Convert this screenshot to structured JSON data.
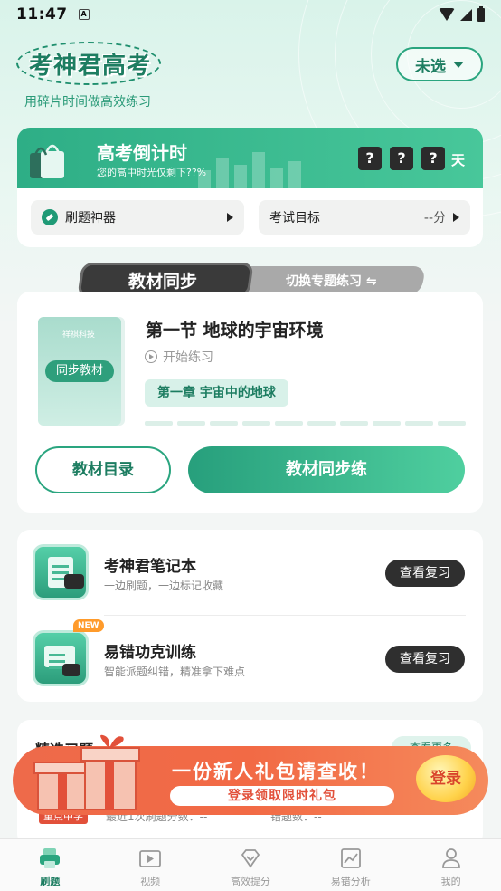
{
  "status_bar": {
    "time": "11:47",
    "sim_label": "A"
  },
  "header": {
    "logo": "考神君高考",
    "slogan": "用碎片时间做高效练习",
    "select_label": "未选"
  },
  "countdown": {
    "title": "高考倒计时",
    "subtitle": "您的高中时光仅剩下??%",
    "digits": [
      "?",
      "?",
      "?"
    ],
    "unit": "天",
    "pill_practice": "刷题神器",
    "pill_goal": "考试目标",
    "goal_value": "--分"
  },
  "tabs": {
    "active": "教材同步",
    "switch": "切换专题练习 ⇋"
  },
  "textbook": {
    "brand": "祥祺科技",
    "badge": "同步教材",
    "section_title": "第一节 地球的宇宙环境",
    "start_label": "开始练习",
    "chapter": "第一章 宇宙中的地球",
    "progress": 0,
    "btn_catalog": "教材目录",
    "btn_practice": "教材同步练"
  },
  "tools": [
    {
      "title": "考神君笔记本",
      "subtitle": "一边刷题，一边标记收藏",
      "button": "查看复习",
      "icon": "notebook-icon",
      "badge": ""
    },
    {
      "title": "易错功克训练",
      "subtitle": "智能派题纠错，精准拿下难点",
      "button": "查看复习",
      "icon": "mistake-training-icon",
      "badge": "NEW"
    }
  ],
  "practice": {
    "title": "精选习题",
    "see_more": "查看更多",
    "school_tag": "重点中学",
    "stat_recent": "最近1次刷题分数：--",
    "stat_wrong": "错题数：--"
  },
  "promo": {
    "title": "一份新人礼包请查收！",
    "subtitle": "登录领取限时礼包",
    "button": "登录"
  },
  "nav": [
    {
      "label": "刷题",
      "icon": "printer-icon",
      "active": true
    },
    {
      "label": "视频",
      "icon": "video-icon",
      "active": false
    },
    {
      "label": "高效提分",
      "icon": "diamond-icon",
      "active": false
    },
    {
      "label": "易错分析",
      "icon": "chart-icon",
      "active": false
    },
    {
      "label": "我的",
      "icon": "user-icon",
      "active": false
    }
  ],
  "colors": {
    "brand": "#1d7d61",
    "accent": "#2aa57f",
    "promo": "#f26a45"
  }
}
